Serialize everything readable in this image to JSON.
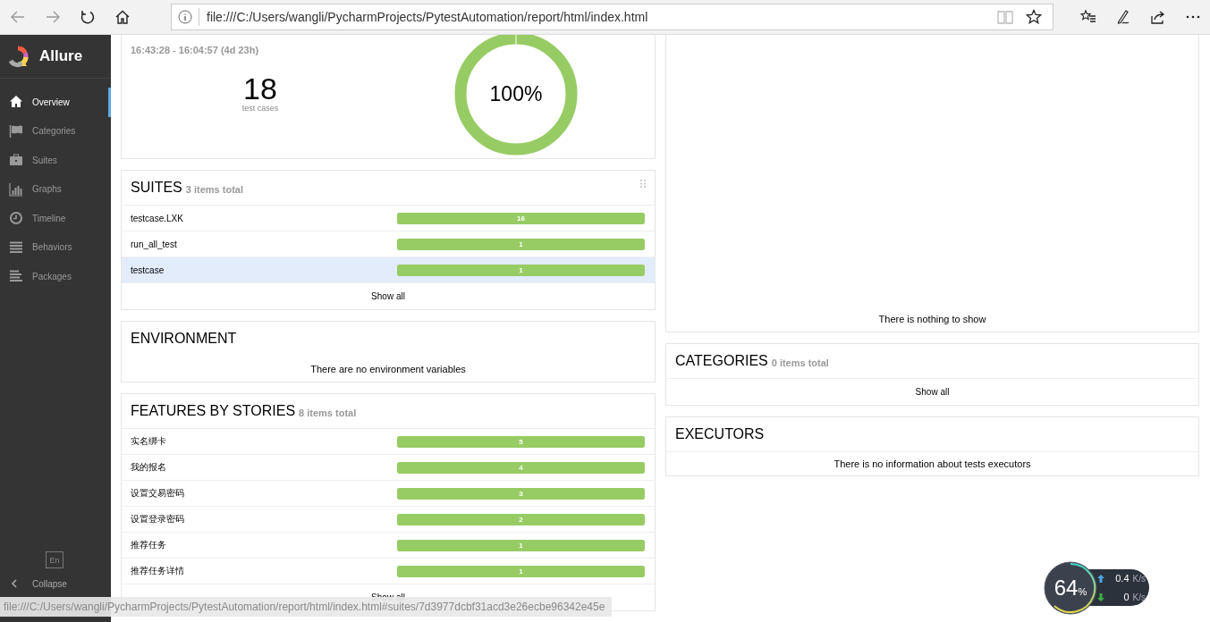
{
  "browser": {
    "url": "file:///C:/Users/wangli/PycharmProjects/PytestAutomation/report/html/index.html",
    "status_url": "file:///C:/Users/wangli/PycharmProjects/PytestAutomation/report/html/index.html#suites/7d3977dcbf31acd3e26ecbe96342e45e"
  },
  "sidebar": {
    "brand": "Allure",
    "items": [
      {
        "kind": "home",
        "label": "Overview",
        "selected": true
      },
      {
        "kind": "flag",
        "label": "Categories",
        "selected": false
      },
      {
        "kind": "briefcase",
        "label": "Suites",
        "selected": false
      },
      {
        "kind": "chart",
        "label": "Graphs",
        "selected": false
      },
      {
        "kind": "clock",
        "label": "Timeline",
        "selected": false
      },
      {
        "kind": "list",
        "label": "Behaviors",
        "selected": false
      },
      {
        "kind": "stack",
        "label": "Packages",
        "selected": false
      }
    ],
    "language": "En",
    "collapse": "Collapse"
  },
  "summary": {
    "time_range": "16:43:28 - 16:04:57 (4d 23h)",
    "count": "18",
    "count_label": "test cases",
    "percent": "100%",
    "level": 1
  },
  "suites": {
    "title": "SUITES",
    "total": "3 items total",
    "rows": [
      {
        "name": "testcase.LXK",
        "count": "16",
        "level": 1,
        "selected": false
      },
      {
        "name": "run_all_test",
        "count": "1",
        "level": 1,
        "selected": false
      },
      {
        "name": "testcase",
        "count": "1",
        "level": 1,
        "selected": true
      }
    ],
    "show_all": "Show all"
  },
  "environment": {
    "title": "ENVIRONMENT",
    "message": "There are no environment variables"
  },
  "features": {
    "title": "FEATURES BY STORIES",
    "total": "8 items total",
    "rows": [
      {
        "name": "实名绑卡",
        "count": "5",
        "level": 1,
        "selected": false
      },
      {
        "name": "我的报名",
        "count": "4",
        "level": 1,
        "selected": false
      },
      {
        "name": "设置交易密码",
        "count": "3",
        "level": 1,
        "selected": false
      },
      {
        "name": "设置登录密码",
        "count": "2",
        "level": 1,
        "selected": false
      },
      {
        "name": "推荐任务",
        "count": "1",
        "level": 1,
        "selected": false
      },
      {
        "name": "推荐任务详情",
        "count": "1",
        "level": 1,
        "selected": false
      }
    ],
    "show_all": "Show all"
  },
  "trend": {
    "message": "There is nothing to show"
  },
  "categories": {
    "title": "CATEGORIES",
    "total": "0 items total",
    "show_all": "Show all"
  },
  "executors": {
    "title": "EXECUTORS",
    "message": "There is no information about tests executors"
  },
  "net_widget": {
    "percent": "64",
    "unit": "%",
    "up": "0.4",
    "up_unit": "K/s",
    "down": "0",
    "down_unit": "K/s"
  }
}
